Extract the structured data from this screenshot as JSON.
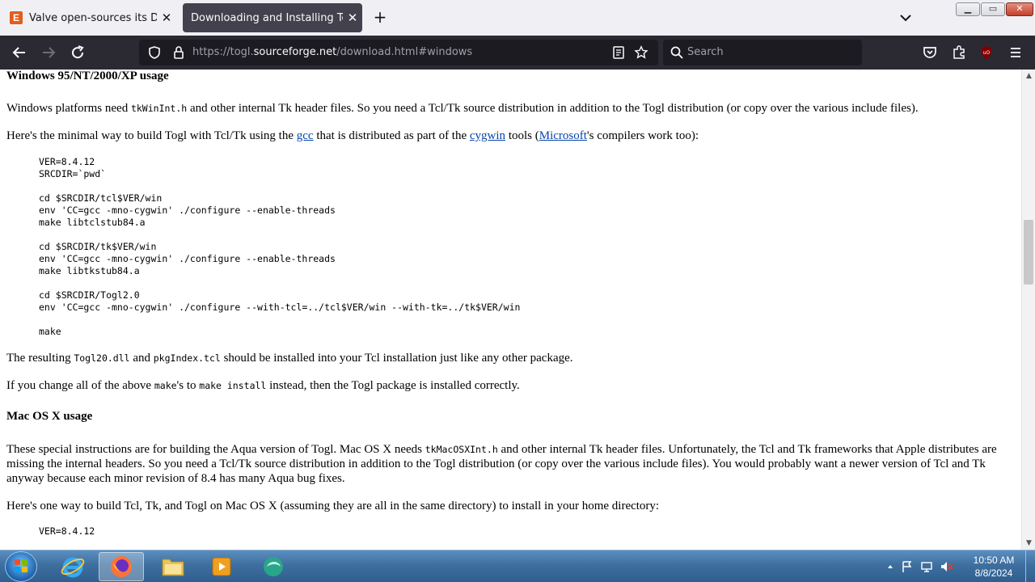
{
  "tabs": [
    {
      "title": "Valve open-sources its DirectX t",
      "active": false,
      "favicon": "escapist-e-icon",
      "favicon_text": "E"
    },
    {
      "title": "Downloading and Installing Togl",
      "active": true
    }
  ],
  "window_controls": {
    "minimize": "▁",
    "maximize": "▭",
    "close": "✕"
  },
  "navbar": {
    "url_prefix": "https://togl.",
    "url_domain": "sourceforge.net",
    "url_suffix": "/download.html#windows",
    "search_placeholder": "Search",
    "ublock_badge": "uO"
  },
  "page": {
    "win_heading": "Windows 95/NT/2000/XP usage",
    "p1": {
      "a": "Windows platforms need ",
      "code": "tkWinInt.h",
      "b": " and other internal Tk header files. So you need a Tcl/Tk source distribution in addition to the Togl distribution (or copy over the various include files)."
    },
    "p2": {
      "a": "Here's the minimal way to build Togl with Tcl/Tk using the ",
      "link1": "gcc",
      "b": " that is distributed as part of the ",
      "link2": "cygwin",
      "c": " tools (",
      "link3": "Microsoft",
      "d": "'s compilers work too):"
    },
    "win_code": "VER=8.4.12\nSRCDIR=`pwd`\n\ncd $SRCDIR/tcl$VER/win\nenv 'CC=gcc -mno-cygwin' ./configure --enable-threads\nmake libtclstub84.a\n\ncd $SRCDIR/tk$VER/win\nenv 'CC=gcc -mno-cygwin' ./configure --enable-threads\nmake libtkstub84.a\n\ncd $SRCDIR/Togl2.0\nenv 'CC=gcc -mno-cygwin' ./configure --with-tcl=../tcl$VER/win --with-tk=../tk$VER/win\n\nmake",
    "p3": {
      "a": "The resulting ",
      "code1": "Togl20.dll",
      "b": " and ",
      "code2": "pkgIndex.tcl",
      "c": " should be installed into your Tcl installation just like any other package."
    },
    "p4": {
      "a": "If you change all of the above ",
      "code1": "make",
      "b": "'s to ",
      "code2": "make install",
      "c": " instead, then the Togl package is installed correctly."
    },
    "mac_heading": "Mac OS X usage",
    "p5": {
      "a": "These special instructions are for building the Aqua version of Togl. Mac OS X needs ",
      "code": "tkMacOSXInt.h",
      "b": " and other internal Tk header files. Unfortunately, the Tcl and Tk frameworks that Apple distributes are missing the internal headers. So you need a Tcl/Tk source distribution in addition to the Togl distribution (or copy over the various include files). You would probably want a newer version of Tcl and Tk anyway because each minor revision of 8.4 has many Aqua bug fixes."
    },
    "p6": "Here's one way to build Tcl, Tk, and Togl on Mac OS X (assuming they are all in the same directory) to install in your home directory:",
    "mac_code": "VER=8.4.12"
  },
  "scrollbar": {
    "up": "▲",
    "down": "▼"
  },
  "taskbar": {
    "apps": [
      "internet-explorer-icon",
      "firefox-icon",
      "file-explorer-icon",
      "media-player-icon",
      "app-icon"
    ],
    "clock_time": "10:50 AM",
    "clock_date": "8/8/2024"
  },
  "colors": {
    "accent_link": "#0645ad",
    "navbar_bg": "#2b2a33",
    "taskbar": "#3e6f9f"
  }
}
